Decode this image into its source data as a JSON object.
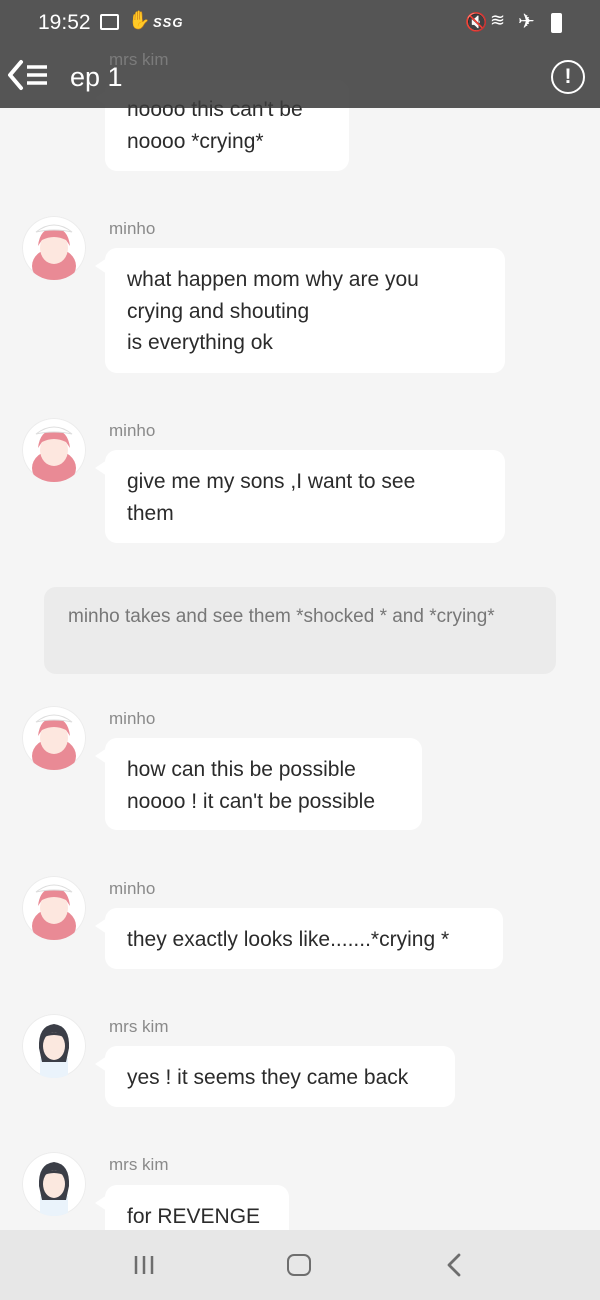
{
  "status_bar": {
    "time": "19:52",
    "carrier_badge": "SSG"
  },
  "header": {
    "title": "ep 1",
    "overlapped_speaker": "mrs kim"
  },
  "messages": [
    {
      "speaker": "mrs kim",
      "avatar": "mrs-kim-avatar-icon",
      "text": "noooo this can't be\nnoooo *crying*"
    },
    {
      "speaker": "minho",
      "avatar": "minho-avatar-icon",
      "text": "what happen mom why are you\ncrying and shouting\nis everything ok"
    },
    {
      "speaker": "minho",
      "avatar": "minho-avatar-icon",
      "text": "give me my sons ,I want to see\nthem"
    },
    {
      "narration": "minho takes and see them  *shocked * and *crying*"
    },
    {
      "speaker": "minho",
      "avatar": "minho-avatar-icon",
      "text": "how can this be possible\nnoooo ! it can't be possible"
    },
    {
      "speaker": "minho",
      "avatar": "minho-avatar-icon",
      "text": "they exactly looks like.......*crying *"
    },
    {
      "speaker": "mrs kim",
      "avatar": "mrs-kim-avatar-icon",
      "text": "yes ! it seems they came back"
    },
    {
      "speaker": "mrs kim",
      "avatar": "mrs-kim-avatar-icon",
      "text": "for REVENGE"
    }
  ],
  "colors": {
    "background": "#f5f5f5",
    "bubble": "#ffffff",
    "narration_bg": "#ebebeb",
    "header_bg": "#3a3a3a",
    "navbar_bg": "#e7e7e7",
    "minho_hair": "#e98a95",
    "mrs_kim_hair": "#3b3e47"
  }
}
